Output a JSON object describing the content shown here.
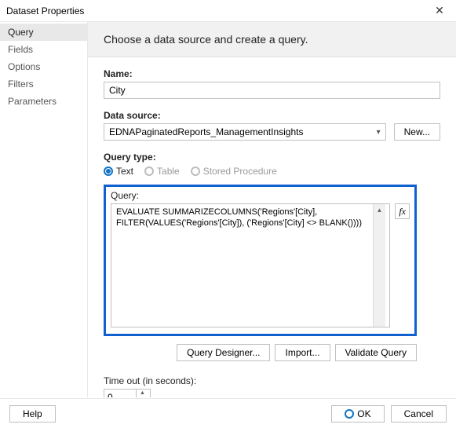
{
  "titlebar": {
    "title": "Dataset Properties"
  },
  "sidebar": {
    "items": [
      {
        "label": "Query"
      },
      {
        "label": "Fields"
      },
      {
        "label": "Options"
      },
      {
        "label": "Filters"
      },
      {
        "label": "Parameters"
      }
    ],
    "selected_index": 0
  },
  "subheader": "Choose a data source and create a query.",
  "labels": {
    "name": "Name:",
    "data_source": "Data source:",
    "query_type": "Query type:",
    "query": "Query:",
    "timeout": "Time out (in seconds):"
  },
  "name": {
    "value": "City"
  },
  "data_source": {
    "value": "EDNAPaginatedReports_ManagementInsights",
    "new_btn": "New..."
  },
  "query_type": {
    "options": [
      {
        "label": "Text",
        "selected": true
      },
      {
        "label": "Table",
        "selected": false
      },
      {
        "label": "Stored Procedure",
        "selected": false
      }
    ]
  },
  "query": {
    "text": "EVALUATE SUMMARIZECOLUMNS('Regions'[City], FILTER(VALUES('Regions'[City]), ('Regions'[City] <> BLANK())))"
  },
  "fx_btn": "fx",
  "buttons": {
    "designer": "Query Designer...",
    "import": "Import...",
    "validate": "Validate Query"
  },
  "timeout": {
    "value": "0"
  },
  "footer": {
    "help": "Help",
    "ok": "OK",
    "cancel": "Cancel"
  }
}
